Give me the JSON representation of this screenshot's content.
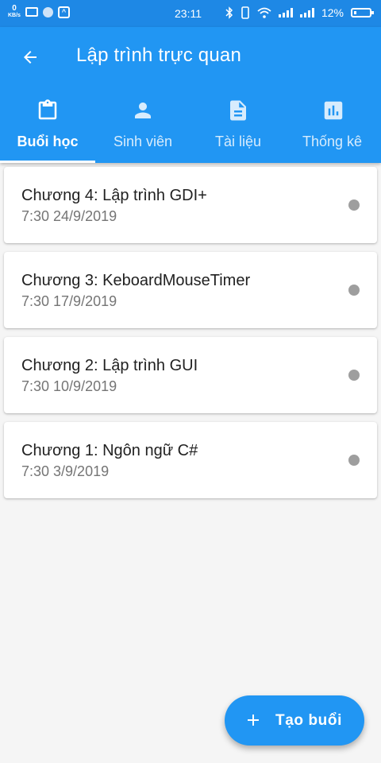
{
  "status_bar": {
    "net_speed": "0",
    "net_unit": "KB/s",
    "time": "23:11",
    "battery": "12%"
  },
  "app_bar": {
    "title": "Lập trình trực quan",
    "back_icon": "arrow-back-icon"
  },
  "tabs": [
    {
      "label": "Buổi học",
      "icon": "clipboard-icon",
      "active": true
    },
    {
      "label": "Sinh viên",
      "icon": "person-icon",
      "active": false
    },
    {
      "label": "Tài liệu",
      "icon": "document-icon",
      "active": false
    },
    {
      "label": "Thống kê",
      "icon": "bar-chart-icon",
      "active": false
    }
  ],
  "sessions": [
    {
      "title": "Chương 4: Lập trình GDI+",
      "datetime": "7:30 24/9/2019"
    },
    {
      "title": "Chương 3: KeboardMouseTimer",
      "datetime": "7:30 17/9/2019"
    },
    {
      "title": "Chương 2: Lập trình GUI",
      "datetime": "7:30 10/9/2019"
    },
    {
      "title": "Chương 1: Ngôn ngữ C#",
      "datetime": "7:30 3/9/2019"
    }
  ],
  "fab": {
    "label": "Tạo buổi",
    "icon": "plus-icon"
  },
  "colors": {
    "primary": "#2196f3",
    "status_bar": "#1e88e5",
    "status_dot": "#9e9e9e",
    "background": "#f5f5f5"
  }
}
